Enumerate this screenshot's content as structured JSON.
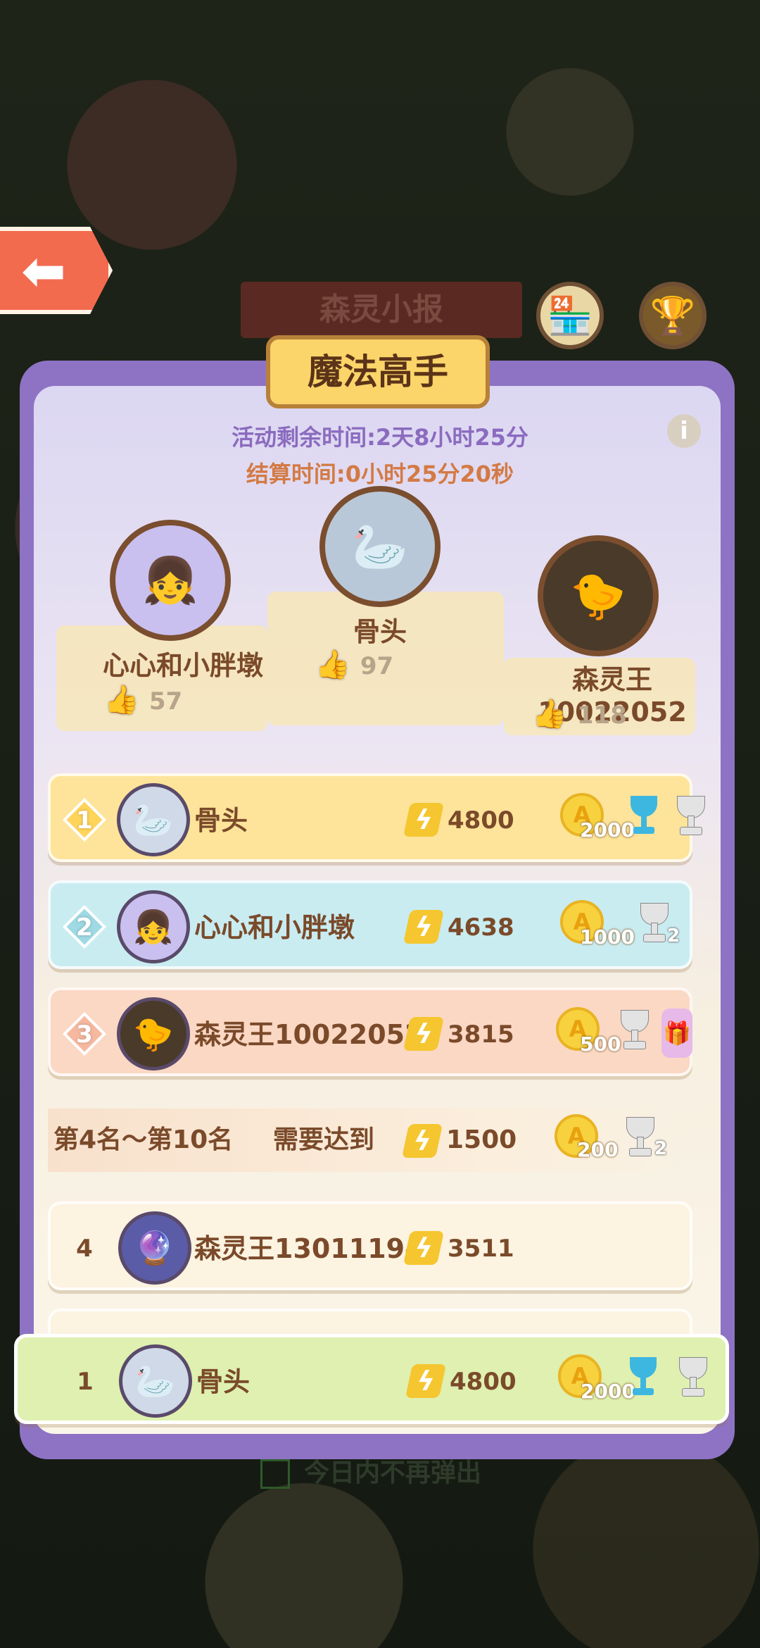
{
  "background": {
    "news_title": "森灵小报",
    "dont_show_today": "今日内不再弹出",
    "back_icon": "back-arrow-icon",
    "shop_icon": "shop-icon",
    "trophy_icon": "trophy-icon"
  },
  "panel": {
    "title": "魔法高手",
    "remaining_time": "活动剩余时间:2天8小时25分",
    "settle_time": "结算时间:0小时25分20秒",
    "info_icon": "info-icon"
  },
  "podium": [
    {
      "place": 2,
      "name": "心心和小胖墩",
      "likes": "57"
    },
    {
      "place": 1,
      "name": "骨头",
      "likes": "97"
    },
    {
      "place": 3,
      "name": "森灵王10022052",
      "likes": "118"
    }
  ],
  "ranking": [
    {
      "rank": "1",
      "name": "骨头",
      "score": "4800",
      "coins": "2000",
      "trophy": "blue",
      "trophy_count": ""
    },
    {
      "rank": "2",
      "name": "心心和小胖墩",
      "score": "4638",
      "coins": "1000",
      "trophy": "silver",
      "trophy_count": "2"
    },
    {
      "rank": "3",
      "name": "森灵王10022052",
      "score": "3815",
      "coins": "500",
      "trophy": "silver",
      "trophy_count": ""
    }
  ],
  "threshold": {
    "range": "第4名～第10名",
    "requirement": "需要达到",
    "score": "1500",
    "coins": "200",
    "trophy_count": "2"
  },
  "rank4": {
    "rank": "4",
    "name": "森灵王13011194",
    "score": "3511"
  },
  "my_rank": {
    "rank": "1",
    "name": "骨头",
    "score": "4800",
    "coins": "2000"
  },
  "colors": {
    "panel": "#8e73c4",
    "gold_row": "#fde49a",
    "cyan_row": "#c9ecf1",
    "peach_row": "#fbd8c4",
    "mine_row": "#dff0b0"
  }
}
